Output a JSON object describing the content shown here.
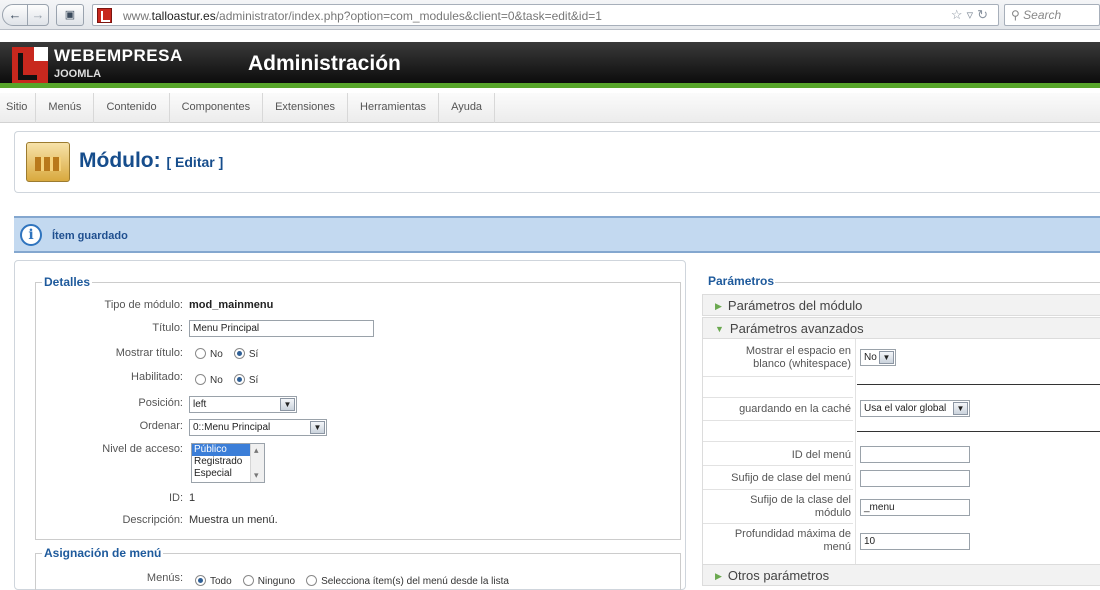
{
  "browser": {
    "url_prefix": "www.",
    "url_host": "talloastur.es",
    "url_path": "/administrator/index.php?option=com_modules&client=0&task=edit&id=1",
    "search_placeholder": "Search"
  },
  "header": {
    "brand": "WEBEMPRESA",
    "brand_sub": "JOOMLA",
    "title": "Administración"
  },
  "menu": [
    "Sitio",
    "Menús",
    "Contenido",
    "Componentes",
    "Extensiones",
    "Herramientas",
    "Ayuda"
  ],
  "toolbar": {
    "title": "Módulo:",
    "subtitle": "[ Editar ]"
  },
  "message": "Ítem guardado",
  "details": {
    "legend": "Detalles",
    "module_type_label": "Tipo de módulo:",
    "module_type_value": "mod_mainmenu",
    "title_label": "Título:",
    "title_value": "Menu Principal",
    "show_title_label": "Mostrar título:",
    "enabled_label": "Habilitado:",
    "no_label": "No",
    "yes_label": "Sí",
    "position_label": "Posición:",
    "position_value": "left",
    "order_label": "Ordenar:",
    "order_value": "0::Menu Principal",
    "access_label": "Nivel de acceso:",
    "access_options": [
      "Público",
      "Registrado",
      "Especial"
    ],
    "id_label": "ID:",
    "id_value": "1",
    "description_label": "Descripción:",
    "description_value": "Muestra un menú."
  },
  "menu_assignment": {
    "legend": "Asignación de menú",
    "menus_label": "Menús:",
    "opt_all": "Todo",
    "opt_none": "Ninguno",
    "opt_select": "Selecciona ítem(s) del menú desde la lista"
  },
  "params": {
    "legend": "Parámetros",
    "module_params": "Parámetros del módulo",
    "advanced_params": "Parámetros avanzados",
    "whitespace_label_1": "Mostrar el espacio en",
    "whitespace_label_2": "blanco (whitespace)",
    "whitespace_value": "No",
    "cache_label": "guardando en la caché",
    "cache_value": "Usa el valor global",
    "menu_id_label": "ID del menú",
    "menu_id_value": "",
    "menu_class_label": "Sufijo de clase del menú",
    "menu_class_value": "",
    "module_class_label_1": "Sufijo de la clase del",
    "module_class_label_2": "módulo",
    "module_class_value": "_menu",
    "max_depth_label_1": "Profundidad máxima de",
    "max_depth_label_2": "menú",
    "max_depth_value": "10",
    "other_params": "Otros parámetros"
  }
}
